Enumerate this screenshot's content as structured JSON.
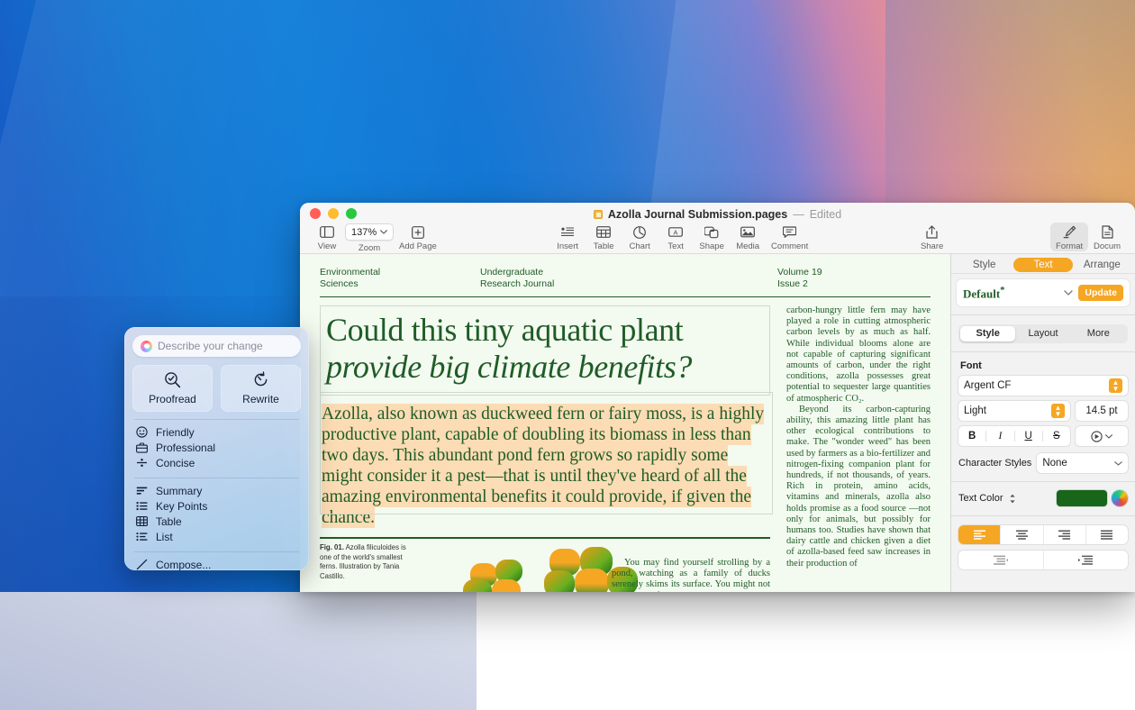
{
  "window": {
    "title": "Azolla Journal Submission.pages",
    "dash": "—",
    "edited": "Edited",
    "app": "Pages"
  },
  "toolbar": {
    "view": "View",
    "zoom_label": "Zoom",
    "zoom_value": "137%",
    "add_page": "Add Page",
    "insert": "Insert",
    "table": "Table",
    "chart": "Chart",
    "text": "Text",
    "shape": "Shape",
    "media": "Media",
    "comment": "Comment",
    "share": "Share",
    "format": "Format",
    "document": "Docum"
  },
  "inspector": {
    "tabs": [
      {
        "label": "Style",
        "selected": false
      },
      {
        "label": "Text",
        "selected": true
      },
      {
        "label": "Arrange",
        "selected": false
      }
    ],
    "paragraph_style": "Default",
    "paragraph_style_marker": "*",
    "update_button": "Update",
    "sub_tabs": [
      {
        "label": "Style",
        "selected": true
      },
      {
        "label": "Layout",
        "selected": false
      },
      {
        "label": "More",
        "selected": false
      }
    ],
    "font_section_label": "Font",
    "font_family": "Argent CF",
    "font_weight": "Light",
    "font_size": "14.5 pt",
    "bold": "B",
    "italic": "I",
    "underline": "U",
    "strikethrough": "S",
    "character_styles_label": "Character Styles",
    "character_styles_value": "None",
    "text_color_label": "Text Color",
    "text_color_value": "#176619",
    "accent_color": "#f5a623",
    "alignment_selected": "left"
  },
  "writing_tools": {
    "input_placeholder": "Describe your change",
    "cards": [
      {
        "label": "Proofread",
        "icon": "magnifier-check-icon"
      },
      {
        "label": "Rewrite",
        "icon": "rewrite-arrow-icon"
      }
    ],
    "tone_items": [
      {
        "label": "Friendly",
        "icon": "smiley-icon"
      },
      {
        "label": "Professional",
        "icon": "briefcase-icon"
      },
      {
        "label": "Concise",
        "icon": "concise-icon"
      }
    ],
    "transform_items": [
      {
        "label": "Summary",
        "icon": "summary-lines-icon"
      },
      {
        "label": "Key Points",
        "icon": "key-points-list-icon"
      },
      {
        "label": "Table",
        "icon": "table-grid-icon"
      },
      {
        "label": "List",
        "icon": "list-icon"
      }
    ],
    "compose_item": {
      "label": "Compose...",
      "icon": "pencil-icon"
    }
  },
  "document": {
    "masthead": {
      "col1_line1": "Environmental",
      "col1_line2": "Sciences",
      "col2_line1": "Undergraduate",
      "col2_line2": "Research Journal",
      "col3_line1": "Volume 19",
      "col3_line2": "Issue 2"
    },
    "headline_line1": "Could this tiny aquatic plant",
    "headline_line2": "provide big climate benefits?",
    "deck": "Azolla, also known as duckweed fern or fairy moss, is a highly productive plant, capable of doubling its biomass in less than two days. This abundant pond fern grows so rapidly some might consider it a pest—that is until they've heard of all the amazing environmental benefits it could provide, if given the chance.",
    "figure_caption_bold": "Fig. 01.",
    "figure_caption": " Azolla filiculoides is one of the world's smallest ferns. Illustration by Tania Castillo.",
    "right_col_p1": "carbon-hungry little fern may have played a role in cutting atmospheric carbon levels by as much as half. While individual blooms alone are not capable of capturing significant amounts of carbon, under the right conditions, azolla possesses great potential to sequester large quantities of atmospheric CO₂.",
    "right_col_p2": "Beyond its carbon-capturing ability, this amazing little plant has other ecological contributions to make. The \"wonder weed\" has been used by farmers as a bio-fertilizer and nitrogen-fixing companion plant for hundreds, if not thousands, of years. Rich in protein, amino acids, vitamins and minerals, azolla also holds promise as a food source —not only for animals, but possibly for humans too. Studies have shown that dairy cattle and chicken given a diet of azolla-based feed saw increases in their production of",
    "lower_col_text": "You may find yourself strolling by a pond, watching as a family of ducks serenely skims its surface. You might not register the free-"
  }
}
